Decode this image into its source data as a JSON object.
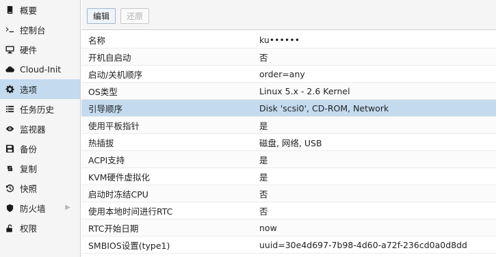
{
  "sidebar": {
    "items": [
      {
        "label": "概要",
        "icon": "book-icon"
      },
      {
        "label": "控制台",
        "icon": "terminal-icon"
      },
      {
        "label": "硬件",
        "icon": "desktop-icon"
      },
      {
        "label": "Cloud-Init",
        "icon": "cloud-icon"
      },
      {
        "label": "选项",
        "icon": "gear-icon",
        "selected": true
      },
      {
        "label": "任务历史",
        "icon": "list-icon"
      },
      {
        "label": "监视器",
        "icon": "eye-icon"
      },
      {
        "label": "备份",
        "icon": "floppy-icon"
      },
      {
        "label": "复制",
        "icon": "retweet-icon"
      },
      {
        "label": "快照",
        "icon": "history-icon"
      },
      {
        "label": "防火墙",
        "icon": "shield-icon",
        "expandable": true
      },
      {
        "label": "权限",
        "icon": "unlock-icon"
      }
    ]
  },
  "toolbar": {
    "edit_label": "编辑",
    "revert_label": "还原"
  },
  "options": {
    "rows": [
      {
        "key": "名称",
        "value": "ku••••••"
      },
      {
        "key": "开机自启动",
        "value": "否"
      },
      {
        "key": "启动/关机顺序",
        "value": "order=any"
      },
      {
        "key": "OS类型",
        "value": "Linux 5.x - 2.6 Kernel"
      },
      {
        "key": "引导顺序",
        "value": "Disk 'scsi0', CD-ROM, Network",
        "selected": true
      },
      {
        "key": "使用平板指针",
        "value": "是"
      },
      {
        "key": "热插拔",
        "value": "磁盘, 网络, USB"
      },
      {
        "key": "ACPI支持",
        "value": "是"
      },
      {
        "key": "KVM硬件虚拟化",
        "value": "是"
      },
      {
        "key": "启动时冻结CPU",
        "value": "否"
      },
      {
        "key": "使用本地时间进行RTC",
        "value": "否"
      },
      {
        "key": "RTC开始日期",
        "value": "now"
      },
      {
        "key": "SMBIOS设置(type1)",
        "value": "uuid=30e4d697-7b98-4d60-a72f-236cd0a0d8dd"
      }
    ]
  },
  "colors": {
    "selection": "#c4dbef",
    "panel_bg": "#f5f5f5"
  }
}
